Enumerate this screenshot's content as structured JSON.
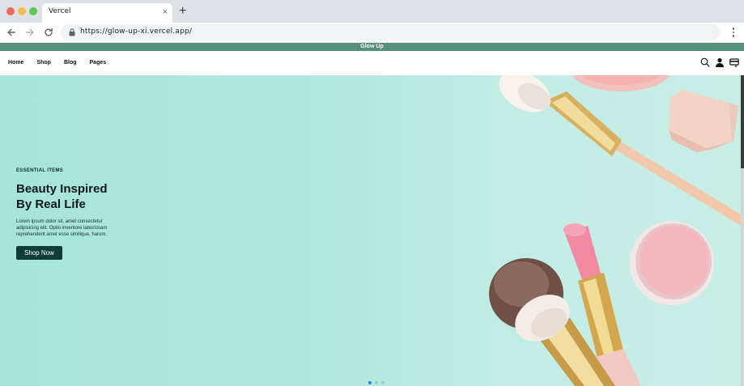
{
  "browser": {
    "tab_title": "Vercel",
    "tab_close": "×",
    "new_tab": "+",
    "url": "https://glow-up-xi.vercel.app/"
  },
  "site": {
    "announcement": "Glow Up",
    "nav": [
      "Home",
      "Shop",
      "Blog",
      "Pages"
    ],
    "icons": [
      "search-icon",
      "user-icon",
      "cart-icon"
    ]
  },
  "hero": {
    "eyebrow": "ESSENTIAL ITEMS",
    "headline_line1": "Beauty Inspired",
    "headline_line2": "By Real Life",
    "description": "Lorem ipsum dolor sit, amet consectetur adipisicing elit. Optio inventore laboriosam reprehenderit amet esse similique, harum.",
    "cta": "Shop Now",
    "slides": 3,
    "active_slide": 1
  },
  "colors": {
    "announcement_bar": "#56907c",
    "hero_bg": "#b3e8dd",
    "cta_bg": "#0e3d35",
    "active_dot": "#1e88e5"
  }
}
